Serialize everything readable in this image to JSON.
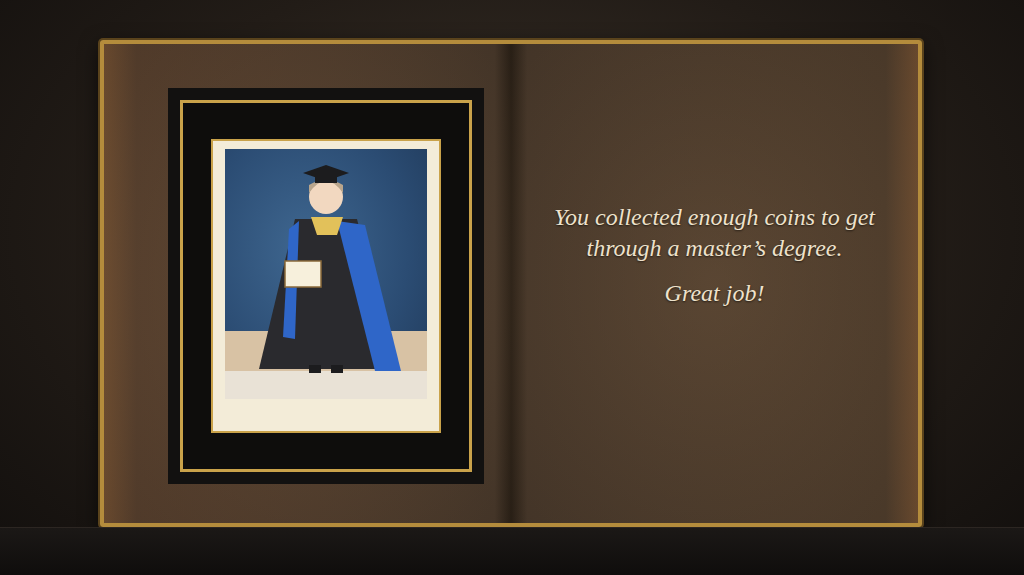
{
  "message": {
    "lines": [
      "You collected enough coins to get",
      "through a master’s degree.",
      "Great job!"
    ]
  }
}
